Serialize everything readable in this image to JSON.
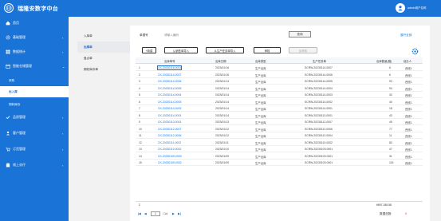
{
  "app": {
    "title": "瑞隆安数字中台",
    "user": "admin用户名称"
  },
  "sidebar": {
    "items": [
      {
        "label": "首页",
        "icon": "home-icon",
        "chev": ""
      },
      {
        "label": "基础管理",
        "icon": "gear-icon",
        "chev": "›"
      },
      {
        "label": "数据统计",
        "icon": "grid-icon",
        "chev": "›"
      },
      {
        "label": "智能仓储管理",
        "icon": "box-icon",
        "chev": "⌄"
      },
      {
        "label": "品质管理",
        "icon": "check-icon",
        "chev": "›"
      },
      {
        "label": "客户管理",
        "icon": "user-icon",
        "chev": "›"
      },
      {
        "label": "订货管理",
        "icon": "cart-icon",
        "chev": "›"
      },
      {
        "label": "线上亦仔",
        "icon": "store-icon",
        "chev": "›"
      }
    ],
    "subs": [
      "采购",
      "出入库",
      "物料库存"
    ]
  },
  "subnav": [
    "入库单",
    "出库单",
    "盘点单",
    "期初库存单"
  ],
  "query": {
    "label": "单据号",
    "value": "请输入编码",
    "button": "查询",
    "link": "展开全部"
  },
  "toolbar": {
    "add": "+新建",
    "import": "从销售单导入",
    "export": "从生产任务单导入",
    "audit": "审核",
    "unaudit": "反审核"
  },
  "grid": {
    "headers": [
      "出库单号",
      "出库日期",
      "出库类型",
      "生产任务单",
      "出库数量(箱)",
      "经办人"
    ],
    "rows": [
      {
        "n": "1",
        "code": "CK-20230116-0001",
        "date": "2023/01/16",
        "type": "生产出库",
        "task": "SCRW-20230114-0007",
        "qty": "6",
        "person": "西班1"
      },
      {
        "n": "2",
        "code": "CK-20230114-0007",
        "date": "2023/01/16",
        "type": "生产出库",
        "task": "SCRW-20230114-0006",
        "qty": "6",
        "person": "西班1"
      },
      {
        "n": "3",
        "code": "CK-20230114-0006",
        "date": "2023/01/14",
        "type": "生产出库",
        "task": "SCRW-20230114-0005",
        "qty": "93",
        "person": "西班1"
      },
      {
        "n": "4",
        "code": "CK-20230114-0005",
        "date": "2023/01/14",
        "type": "生产出库",
        "task": "SCRW-20230114-0004",
        "qty": "94",
        "person": "西班1"
      },
      {
        "n": "5",
        "code": "CK-20230114-0004",
        "date": "2023/01/14",
        "type": "生产出库",
        "task": "SCRW-20230114-0003",
        "qty": "30",
        "person": "西班1"
      },
      {
        "n": "6",
        "code": "CK-20230114-0003",
        "date": "2023/01/14",
        "type": "生产出库",
        "task": "SCRW-20230114-0002",
        "qty": "40",
        "person": "西班1"
      },
      {
        "n": "7",
        "code": "CK-20230114-0002",
        "date": "2023/01/14",
        "type": "生产出库",
        "task": "SCRW-20230114-0001",
        "qty": "18",
        "person": "西班1"
      },
      {
        "n": "8",
        "code": "CK-20230114-0001",
        "date": "2023/01/14",
        "type": "生产出库",
        "task": "SCRW-20230113-0001",
        "qty": "43",
        "person": "西班1"
      },
      {
        "n": "9",
        "code": "CK-20230113-0001",
        "date": "2023/01/13",
        "type": "生产出库",
        "task": "SCRW-20230112-0007",
        "qty": "45",
        "person": "西班1"
      },
      {
        "n": "10",
        "code": "CK-20230112-0007",
        "date": "2023/01/12",
        "type": "生产出库",
        "task": "SCRW-20230112-0006",
        "qty": "77",
        "person": "西班1"
      },
      {
        "n": "11",
        "code": "CK-20230112-0006",
        "date": "2023/01/12",
        "type": "生产出库",
        "task": "SCRW-20230112-0004",
        "qty": "11",
        "person": "西班1"
      },
      {
        "n": "12",
        "code": "CK-20230111-0002",
        "date": "2023/01/11",
        "type": "生产出库",
        "task": "SCRW-20230110-0002",
        "qty": "83",
        "person": "西班1"
      },
      {
        "n": "13",
        "code": "CK-20230110-0002",
        "date": "2023/01/10",
        "type": "生产出库",
        "task": "SCRW-20230109-0001",
        "qty": "47",
        "person": "西班1"
      },
      {
        "n": "14",
        "code": "CK-20230109-0003",
        "date": "2023/01/09",
        "type": "生产出库",
        "task": "SCRW-20230109-0001",
        "qty": "31",
        "person": "西班1"
      },
      {
        "n": "15",
        "code": "CK-20230109-0002",
        "date": "2023/01/09",
        "type": "生产出库",
        "task": "SCRW-20230109-0001",
        "qty": "115",
        "person": "西班1"
      }
    ],
    "sum_label": "Σ",
    "sum_value": "¥697,185.58"
  },
  "pager": {
    "first": "|◀",
    "prev": "◀",
    "page": "1",
    "total": "/ 14",
    "next": "▶",
    "last": "▶|",
    "summary": "数据总数:",
    "count": "0"
  }
}
